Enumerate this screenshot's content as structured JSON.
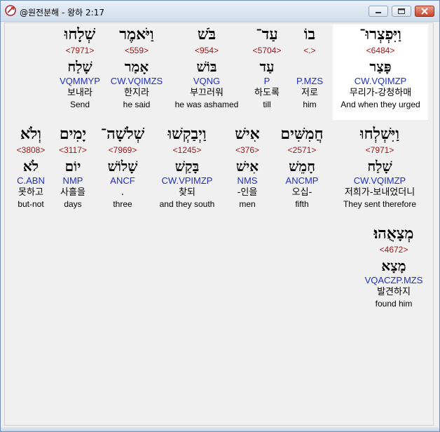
{
  "window": {
    "title": "@원전분해 - 왕하 2:17",
    "minimize_icon": "minimize-icon",
    "maximize_icon": "maximize-icon",
    "close_icon": "close-icon"
  },
  "colors": {
    "strong_number": "#9b1515",
    "parsing": "#1d2fc4",
    "highlight": "#ffffff"
  },
  "words": [
    {
      "heb": "וַיִּפְצְרוּ־",
      "strong": "<6484>",
      "lemma": "פָּצַר",
      "parse": "CW.VQIMZP",
      "kor": "무리가-강청하매",
      "eng": "And when they urged",
      "highlight": true
    },
    {
      "heb": "בוֹ",
      "strong": "<.>",
      "lemma": "",
      "parse": "P.MZS",
      "kor": "저로",
      "eng": "him"
    },
    {
      "heb": "עַד־",
      "strong": "<5704>",
      "lemma": "עַד",
      "parse": "P",
      "kor": "하도록",
      "eng": "till"
    },
    {
      "heb": "בֹּשׁ",
      "strong": "<954>",
      "lemma": "בּוֹשׁ",
      "parse": "VQNG",
      "kor": "부끄러워",
      "eng": "he was ashamed"
    },
    {
      "heb": "וַיֹּאמֶר",
      "strong": "<559>",
      "lemma": "אָמַר",
      "parse": "CW.VQIMZS",
      "kor": "한지라",
      "eng": "he said"
    },
    {
      "heb": "שְׁלָחוּ",
      "strong": "<7971>",
      "lemma": "שָׁלַח",
      "parse": "VQMMYP",
      "kor": "보내라",
      "eng": "Send"
    },
    {
      "heb": "וַיִּשְׁלְחוּ",
      "strong": "<7971>",
      "lemma": "שָׁלַח",
      "parse": "CW.VQIMZP",
      "kor": "저희가-보내었더니",
      "eng": "They sent therefore"
    },
    {
      "heb": "חֲמִשִּׁים",
      "strong": "<2571>",
      "lemma": "חָמֵשׁ",
      "parse": "ANCMP",
      "kor": "오십-",
      "eng": "fifth"
    },
    {
      "heb": "אִישׁ",
      "strong": "<376>",
      "lemma": "אִישׁ",
      "parse": "NMS",
      "kor": "-인을",
      "eng": "men"
    },
    {
      "heb": "וַיְבַקְשׁוּ",
      "strong": "<1245>",
      "lemma": "בָּקַשׁ",
      "parse": "CW.VPIMZP",
      "kor": "찾되",
      "eng": "and they south"
    },
    {
      "heb": "שְׁלֹשָׁה־",
      "strong": "<7969>",
      "lemma": "שָׁלוֹשׁ",
      "parse": "ANCF",
      "kor": ".",
      "eng": "three"
    },
    {
      "heb": "יָמִים",
      "strong": "<3117>",
      "lemma": "יוֹם",
      "parse": "NMP",
      "kor": "사흘을",
      "eng": "days"
    },
    {
      "heb": "וְלֹא",
      "strong": "<3808>",
      "lemma": "לֹא",
      "parse": "C.ABN",
      "kor": "못하고",
      "eng": "but-not"
    },
    {
      "heb": "מְצָאֻהוּ׃",
      "strong": "<4672>",
      "lemma": "מָצָא",
      "parse": "VQACZP.MZS",
      "kor": "발견하지",
      "eng": "found him"
    }
  ]
}
